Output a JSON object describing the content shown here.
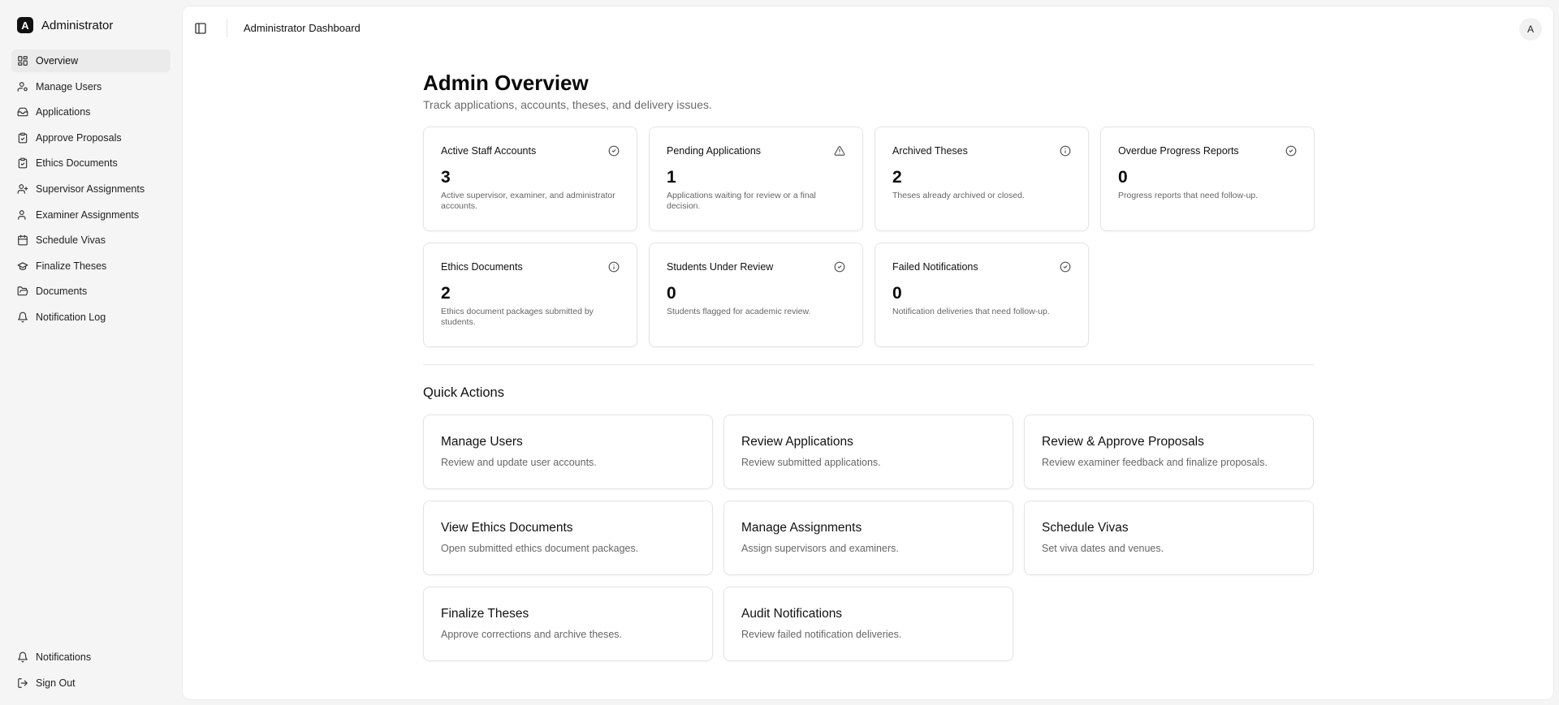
{
  "app": {
    "name": "Administrator",
    "logo_letter": "A"
  },
  "sidebar": {
    "items": [
      {
        "label": "Overview",
        "icon": "layout-grid-icon",
        "active": true
      },
      {
        "label": "Manage Users",
        "icon": "user-cog-icon"
      },
      {
        "label": "Applications",
        "icon": "inbox-icon"
      },
      {
        "label": "Approve Proposals",
        "icon": "clipboard-check-icon"
      },
      {
        "label": "Ethics Documents",
        "icon": "clipboard-check-icon"
      },
      {
        "label": "Supervisor Assignments",
        "icon": "user-plus-icon"
      },
      {
        "label": "Examiner Assignments",
        "icon": "user-icon"
      },
      {
        "label": "Schedule Vivas",
        "icon": "calendar-icon"
      },
      {
        "label": "Finalize Theses",
        "icon": "graduation-cap-icon"
      },
      {
        "label": "Documents",
        "icon": "folder-open-icon"
      },
      {
        "label": "Notification Log",
        "icon": "bell-icon"
      }
    ],
    "bottom_items": [
      {
        "label": "Notifications",
        "icon": "bell-icon"
      },
      {
        "label": "Sign Out",
        "icon": "log-out-icon"
      }
    ]
  },
  "header": {
    "title": "Administrator Dashboard",
    "avatar_letter": "A"
  },
  "main": {
    "title": "Admin Overview",
    "subtitle": "Track applications, accounts, theses, and delivery issues.",
    "stats": [
      {
        "title": "Active Staff Accounts",
        "value": "3",
        "description": "Active supervisor, examiner, and administrator accounts.",
        "icon": "check-circle-icon"
      },
      {
        "title": "Pending Applications",
        "value": "1",
        "description": "Applications waiting for review or a final decision.",
        "icon": "alert-triangle-icon"
      },
      {
        "title": "Archived Theses",
        "value": "2",
        "description": "Theses already archived or closed.",
        "icon": "info-icon"
      },
      {
        "title": "Overdue Progress Reports",
        "value": "0",
        "description": "Progress reports that need follow-up.",
        "icon": "check-circle-icon"
      },
      {
        "title": "Ethics Documents",
        "value": "2",
        "description": "Ethics document packages submitted by students.",
        "icon": "info-icon"
      },
      {
        "title": "Students Under Review",
        "value": "0",
        "description": "Students flagged for academic review.",
        "icon": "check-circle-icon"
      },
      {
        "title": "Failed Notifications",
        "value": "0",
        "description": "Notification deliveries that need follow-up.",
        "icon": "check-circle-icon"
      }
    ],
    "quick_actions_title": "Quick Actions",
    "quick_actions": [
      {
        "title": "Manage Users",
        "description": "Review and update user accounts."
      },
      {
        "title": "Review Applications",
        "description": "Review submitted applications."
      },
      {
        "title": "Review & Approve Proposals",
        "description": "Review examiner feedback and finalize proposals."
      },
      {
        "title": "View Ethics Documents",
        "description": "Open submitted ethics document packages."
      },
      {
        "title": "Manage Assignments",
        "description": "Assign supervisors and examiners."
      },
      {
        "title": "Schedule Vivas",
        "description": "Set viva dates and venues."
      },
      {
        "title": "Finalize Theses",
        "description": "Approve corrections and archive theses."
      },
      {
        "title": "Audit Notifications",
        "description": "Review failed notification deliveries."
      }
    ]
  }
}
